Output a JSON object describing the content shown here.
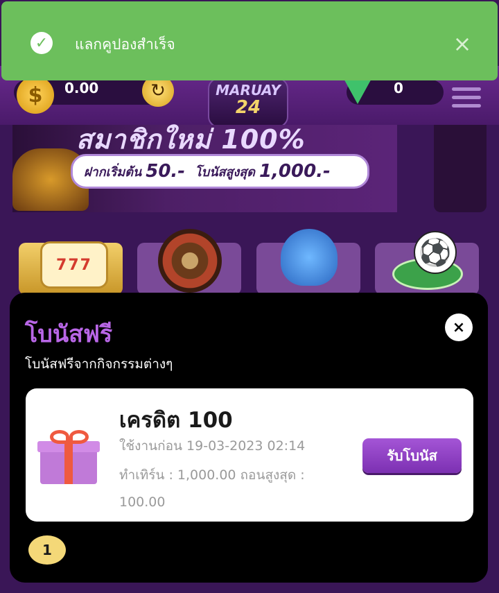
{
  "toast": {
    "message": "แลกคูปองสำเร็จ",
    "check_icon": "check-circle-icon",
    "close_icon": "close-icon"
  },
  "header": {
    "balance": "0.00",
    "coin_icon": "dollar-coin-icon",
    "logo_line1": "MARUAY",
    "logo_line2": "24",
    "gems": "0"
  },
  "banner": {
    "title": "สมาชิกใหม่ 100%",
    "deposit_label": "ฝากเริ่มต้น",
    "deposit_value": "50.-",
    "max_label": "โบนัสสูงสุด",
    "max_value": "1,000.-"
  },
  "categories": [
    {
      "name": "slot"
    },
    {
      "name": "roulette"
    },
    {
      "name": "fishing"
    },
    {
      "name": "football"
    }
  ],
  "modal": {
    "title": "โบนัสฟรี",
    "subtitle": "โบนัสฟรีจากกิจกรรมต่างๆ",
    "close_symbol": "×",
    "card": {
      "title": "เครดิต 100",
      "expire": "ใช้งานก่อน 19-03-2023 02:14",
      "turnover": "ทำเทิร์น : 1,000.00 ถอนสูงสุด : 100.00",
      "button": "รับโบนัส"
    },
    "page": "1"
  },
  "colors": {
    "toast_bg": "#6cbf5c",
    "modal_bg": "#000000",
    "accent_purple": "#b866e6",
    "button_purple": "#8e3fc4",
    "page_badge": "#f4d878"
  }
}
